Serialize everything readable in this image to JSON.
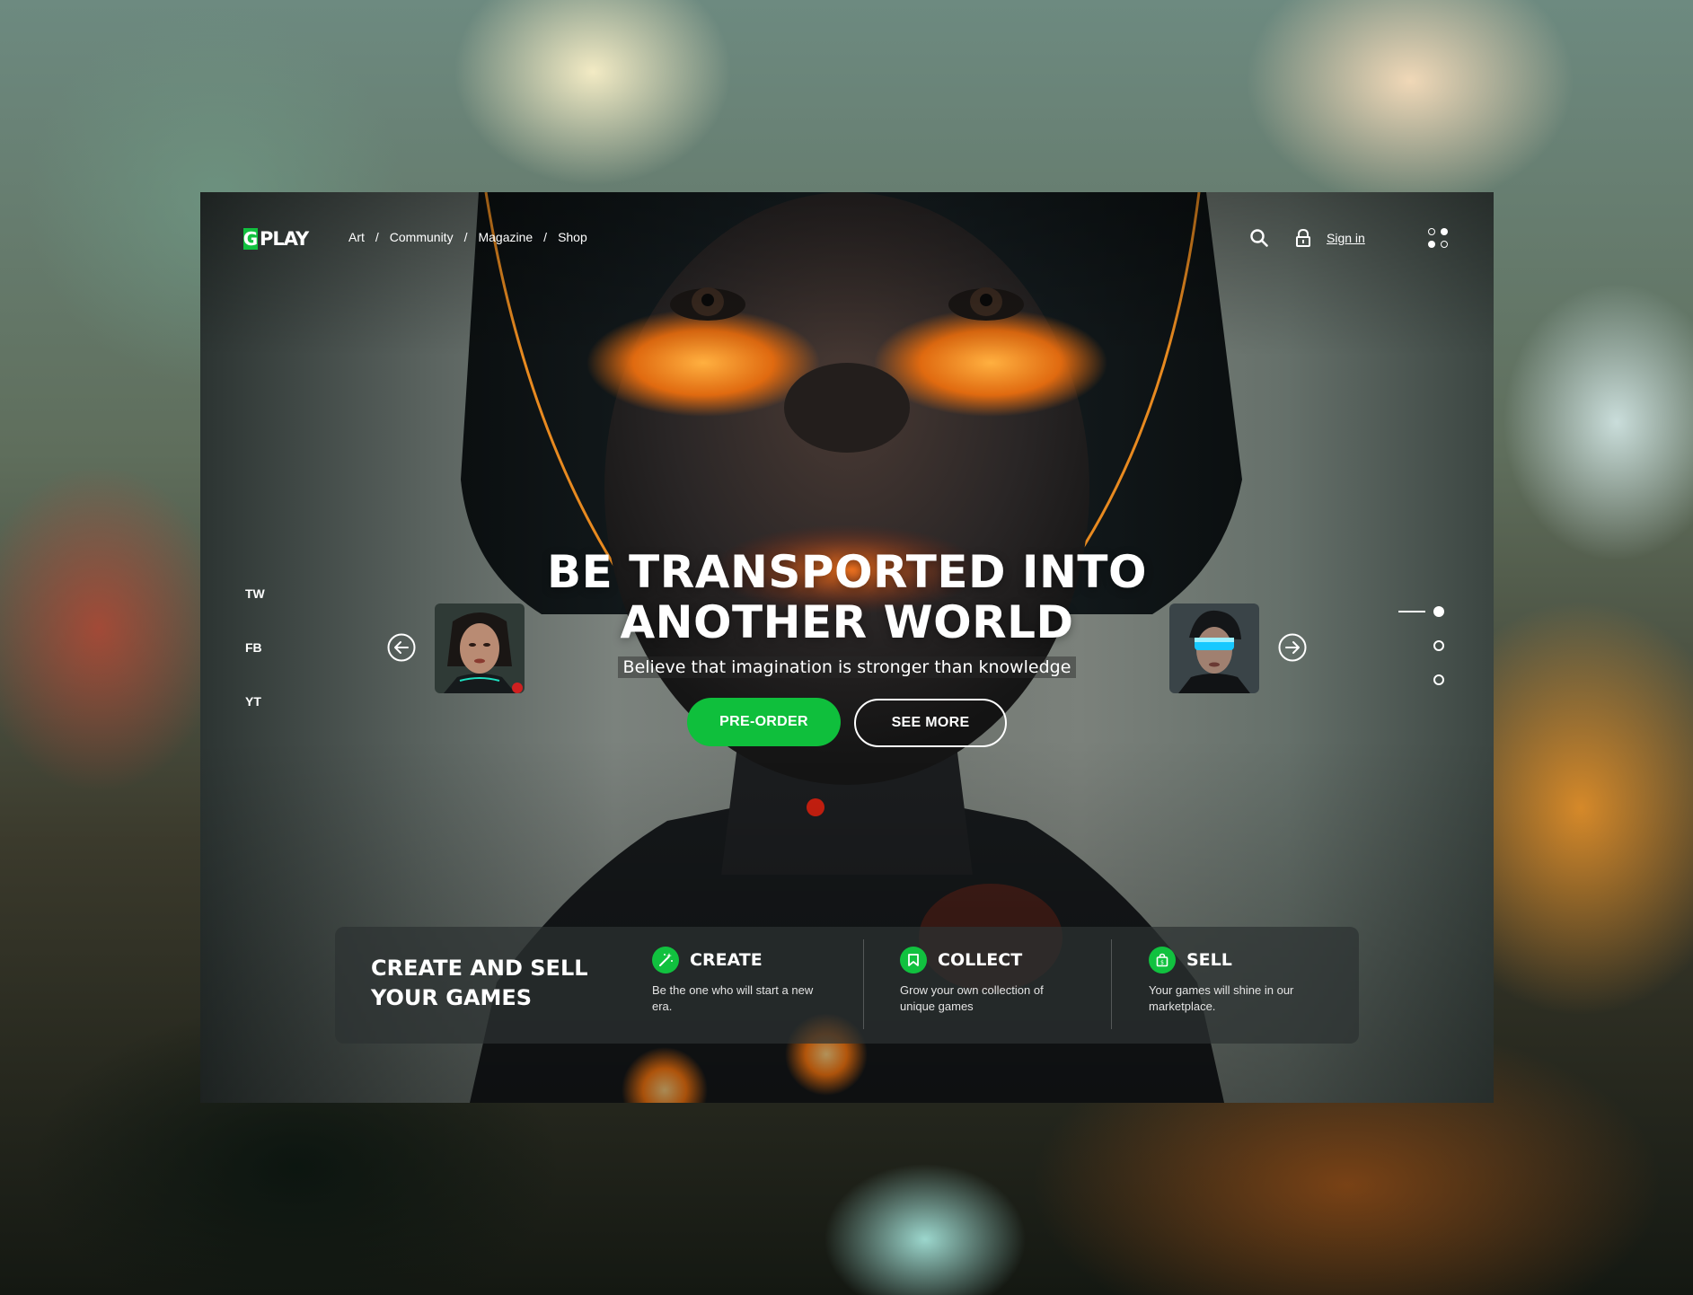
{
  "brand": {
    "logo_mark": "G",
    "logo_text": "PLAY",
    "accent": "#11c13f"
  },
  "nav": {
    "items": [
      "Art",
      "Community",
      "Magazine",
      "Shop"
    ],
    "separator": "/"
  },
  "header": {
    "search_icon": "search-icon",
    "lock_icon": "lock-icon",
    "signin_label": "Sign in",
    "menu_icon": "grid-dots-icon"
  },
  "social": [
    "TW",
    "FB",
    "YT"
  ],
  "hero": {
    "headline_line1": "BE TRANSPORTED INTO",
    "headline_line2": "ANOTHER WORLD",
    "tagline": "Believe that imagination is stronger than knowledge",
    "preorder_label": "PRE-ORDER",
    "seemore_label": "SEE MORE"
  },
  "carousel": {
    "prev_icon": "arrow-left-icon",
    "next_icon": "arrow-right-icon",
    "slide_count": 3,
    "active_slide": 1
  },
  "panel": {
    "title_line1": "CREATE AND SELL",
    "title_line2": "YOUR GAMES",
    "features": [
      {
        "icon": "magic-wand-icon",
        "title": "CREATE",
        "desc": "Be the one who will start a new era."
      },
      {
        "icon": "bookmark-icon",
        "title": "COLLECT",
        "desc": "Grow your own collection of unique games"
      },
      {
        "icon": "shopping-bag-icon",
        "title": "SELL",
        "desc": "Your games will shine in our marketplace."
      }
    ]
  }
}
